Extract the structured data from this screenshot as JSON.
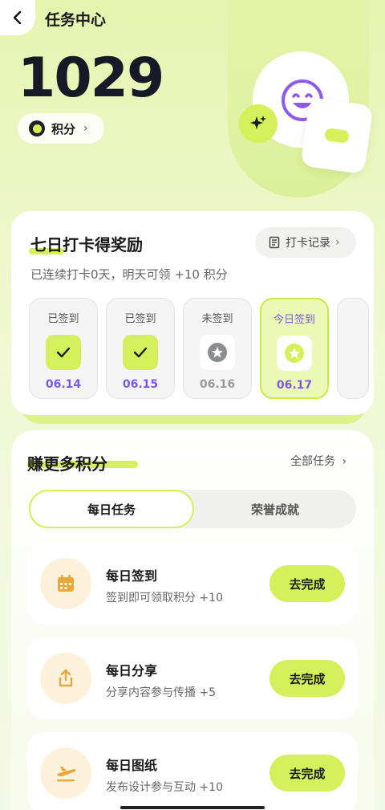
{
  "header": {
    "title": "任务中心"
  },
  "points": {
    "value": "1029",
    "label": "积分",
    "chevron": "›"
  },
  "checkin": {
    "title": "七日打卡得奖励",
    "record_label": "打卡记录",
    "subtitle": "已连续打卡0天，明天可领 +10 积分",
    "days": [
      {
        "status": "已签到",
        "date": "06.14"
      },
      {
        "status": "已签到",
        "date": "06.15"
      },
      {
        "status": "未签到",
        "date": "06.16"
      },
      {
        "status": "今日签到",
        "date": "06.17"
      }
    ]
  },
  "earn": {
    "title": "赚更多积分",
    "all_tasks": "全部任务",
    "tabs": [
      {
        "label": "每日任务"
      },
      {
        "label": "荣誉成就"
      }
    ],
    "tasks": [
      {
        "name": "每日签到",
        "desc": "签到即可领取积分 +10",
        "button": "去完成",
        "icon": "calendar-icon"
      },
      {
        "name": "每日分享",
        "desc": "分享内容参与传播 +5",
        "button": "去完成",
        "icon": "share-icon"
      },
      {
        "name": "每日图纸",
        "desc": "发布设计参与互动 +10",
        "button": "去完成",
        "icon": "plane-icon"
      }
    ]
  },
  "colors": {
    "accent": "#d5f05a",
    "purple": "#7b58e6",
    "icon_orange": "#e9a63a"
  }
}
